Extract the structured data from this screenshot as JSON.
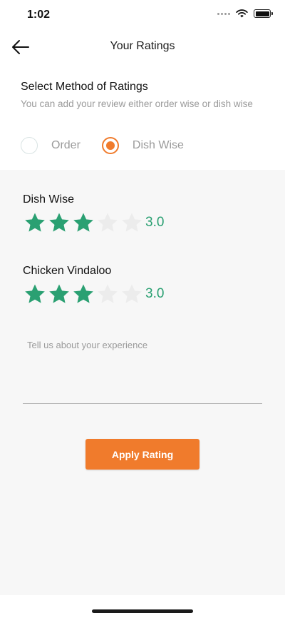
{
  "status_bar": {
    "time": "1:02",
    "icons": [
      "signal-icon",
      "wifi-icon",
      "battery-icon"
    ]
  },
  "header": {
    "back_icon": "arrow-left-icon",
    "title": "Your Ratings"
  },
  "method": {
    "title": "Select Method of Ratings",
    "subtitle": "You can add your review either order wise or dish wise",
    "options": [
      {
        "label": "Order",
        "selected": false
      },
      {
        "label": "Dish Wise",
        "selected": true
      }
    ]
  },
  "ratings": [
    {
      "name": "Dish Wise",
      "stars": 3,
      "max_stars": 5,
      "value": "3.0"
    },
    {
      "name": "Chicken Vindaloo",
      "stars": 3,
      "max_stars": 5,
      "value": "3.0"
    }
  ],
  "review": {
    "placeholder": "Tell us about your experience",
    "value": ""
  },
  "actions": {
    "apply_label": "Apply Rating"
  },
  "colors": {
    "accent": "#f07b2c",
    "star_filled": "#2aa072",
    "star_empty": "#ececec",
    "panel_bg": "#f7f7f7"
  }
}
